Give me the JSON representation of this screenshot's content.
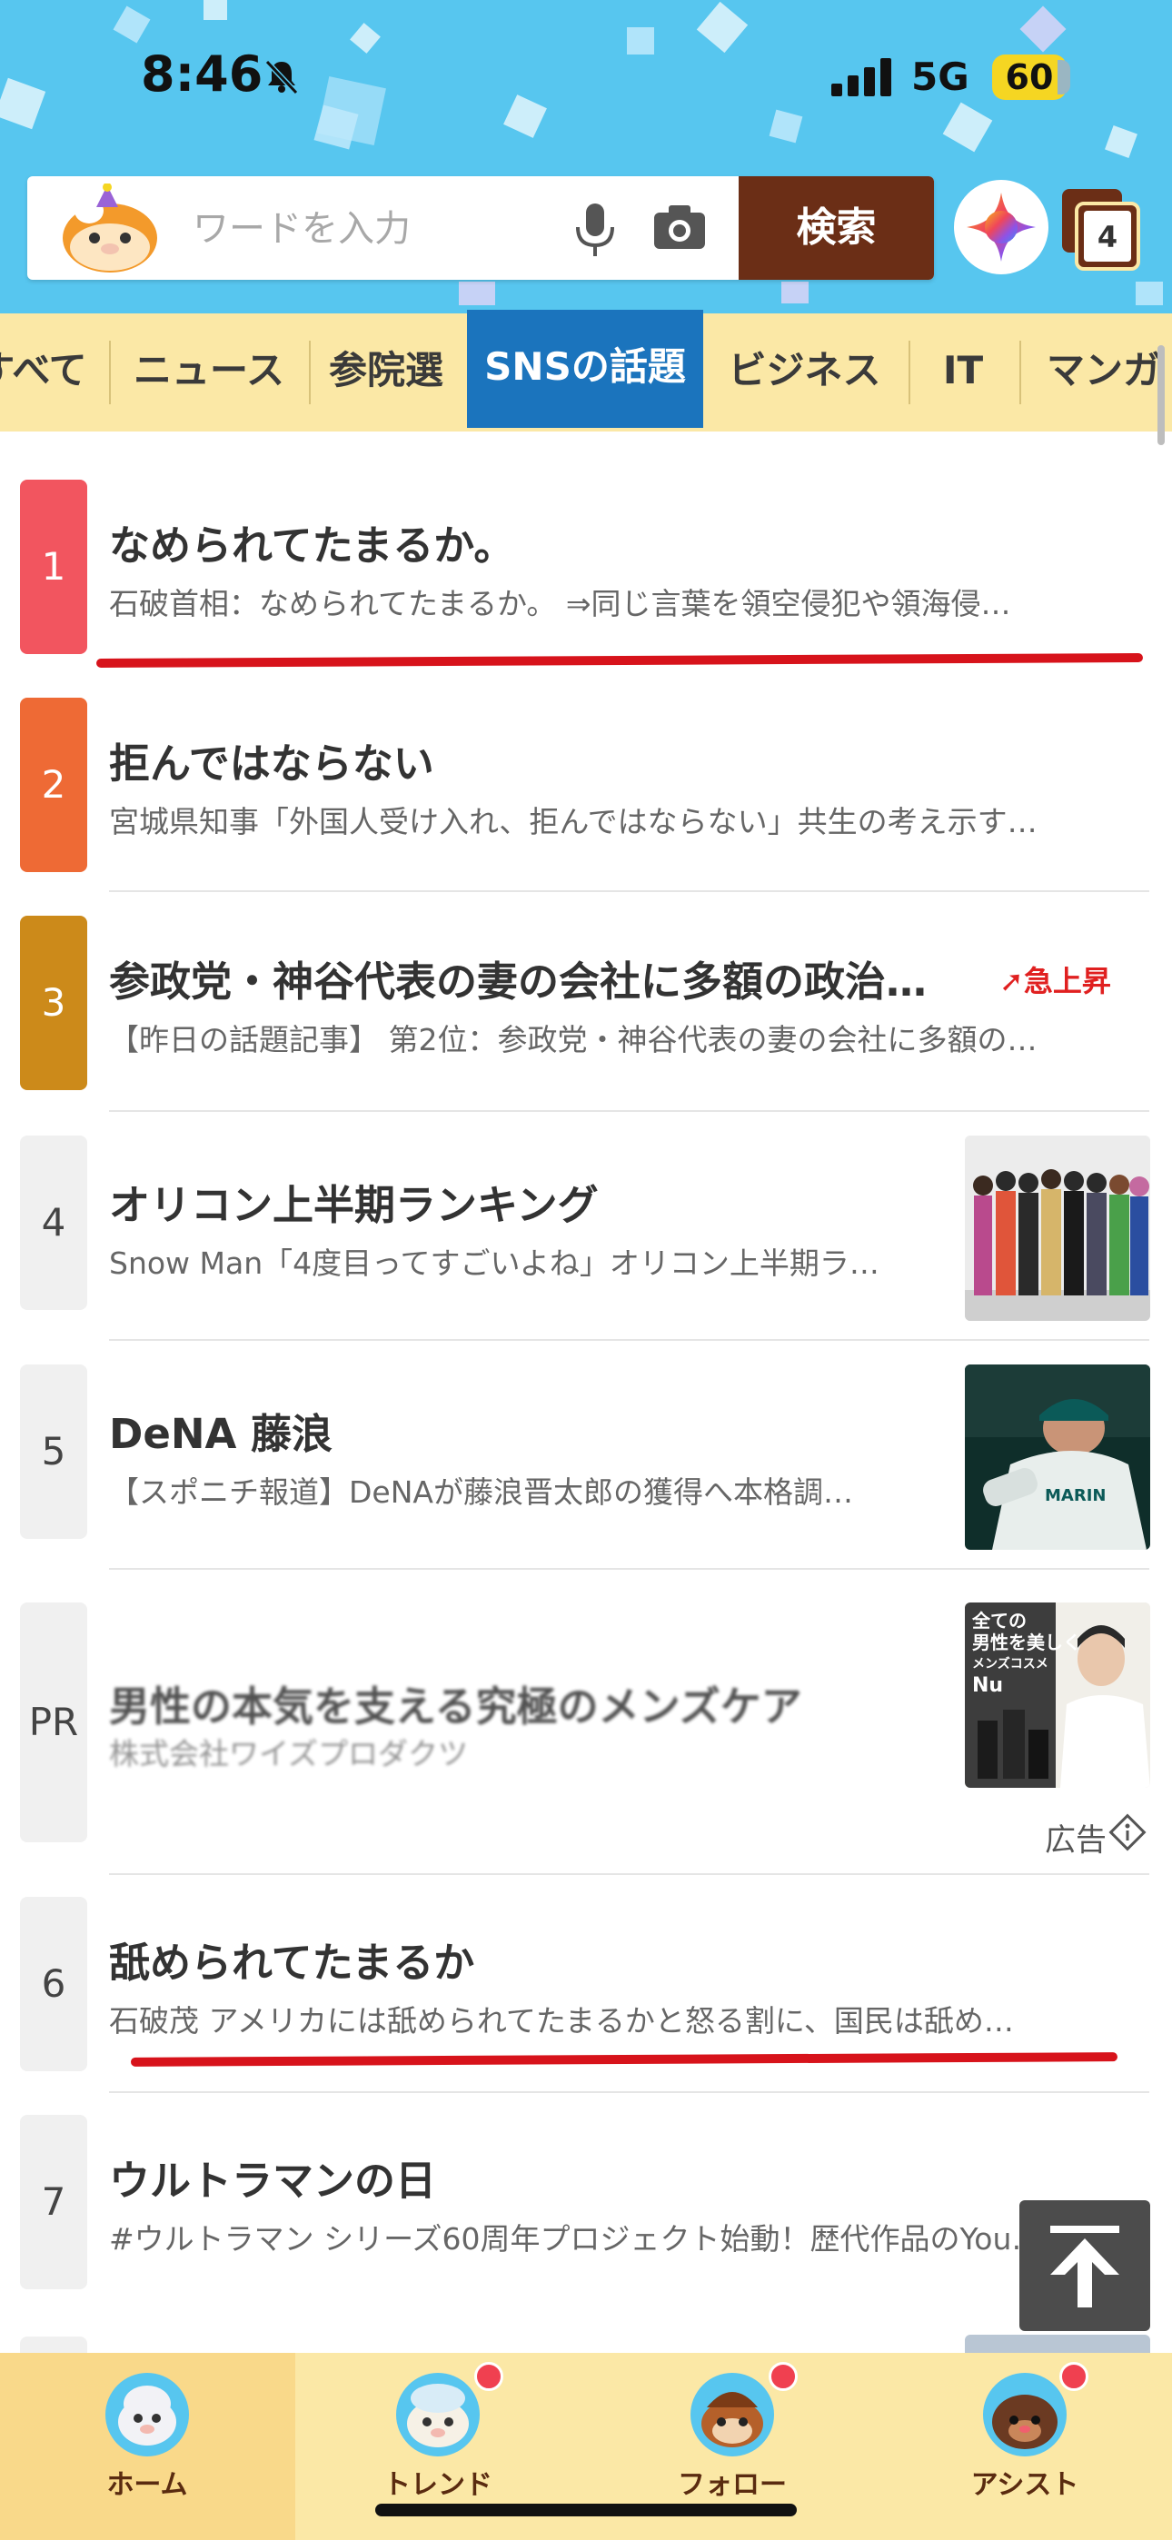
{
  "status_bar": {
    "time": "8:46",
    "network": "5G",
    "battery": "60"
  },
  "search": {
    "placeholder": "ワードを入力",
    "button_label": "検索",
    "tab_count": "4"
  },
  "category_tabs": [
    {
      "label": "すべて",
      "active": false
    },
    {
      "label": "ニュース",
      "active": false
    },
    {
      "label": "参院選",
      "active": false
    },
    {
      "label": "SNSの話題",
      "active": true
    },
    {
      "label": "ビジネス",
      "active": false
    },
    {
      "label": "IT",
      "active": false
    },
    {
      "label": "マンガ",
      "active": false
    }
  ],
  "trends": [
    {
      "rank": "1",
      "title": "なめられてたまるか。",
      "subtitle": "石破首相：なめられてたまるか。 ⇒同じ言葉を領空侵犯や領海侵…",
      "color": "#f2555f"
    },
    {
      "rank": "2",
      "title": "拒んではならない",
      "subtitle": "宮城県知事「外国人受け入れ、拒んではならない」共生の考え示す…",
      "color": "#ee6a35"
    },
    {
      "rank": "3",
      "title": "参政党・神谷代表の妻の会社に多額の政治…",
      "subtitle": "【昨日の話題記事】 第2位：参政党・神谷代表の妻の会社に多額の…",
      "color": "#cc8a1a",
      "badge": "急上昇"
    },
    {
      "rank": "4",
      "title": "オリコン上半期ランキング",
      "subtitle": "Snow Man「4度目ってすごいよね」オリコン上半期ラ…"
    },
    {
      "rank": "5",
      "title": "DeNA 藤浪",
      "subtitle": "【スポニチ報道】DeNAが藤浪晋太郎の獲得へ本格調…"
    },
    {
      "rank": "6",
      "title": "舐められてたまるか",
      "subtitle": "石破茂 アメリカには舐められてたまるかと怒る割に、国民は舐め…"
    },
    {
      "rank": "7",
      "title": "ウルトラマンの日",
      "subtitle": "#ウルトラマン シリーズ60周年プロジェクト始動！歴代作品のYou…"
    }
  ],
  "ad": {
    "rank": "PR",
    "title": "男性の本気を支える究極のメンズケア",
    "advertiser": "株式会社ワイズプロダクツ",
    "label": "広告",
    "image_text_line1": "全ての",
    "image_text_line2": "男性を美しく",
    "image_text_line3": "メンズコスメ",
    "image_brand": "Nu"
  },
  "bottom_nav": [
    {
      "label": "ホーム",
      "active": true
    },
    {
      "label": "トレンド",
      "active": false
    },
    {
      "label": "フォロー",
      "active": false
    },
    {
      "label": "アシスト",
      "active": false
    }
  ]
}
